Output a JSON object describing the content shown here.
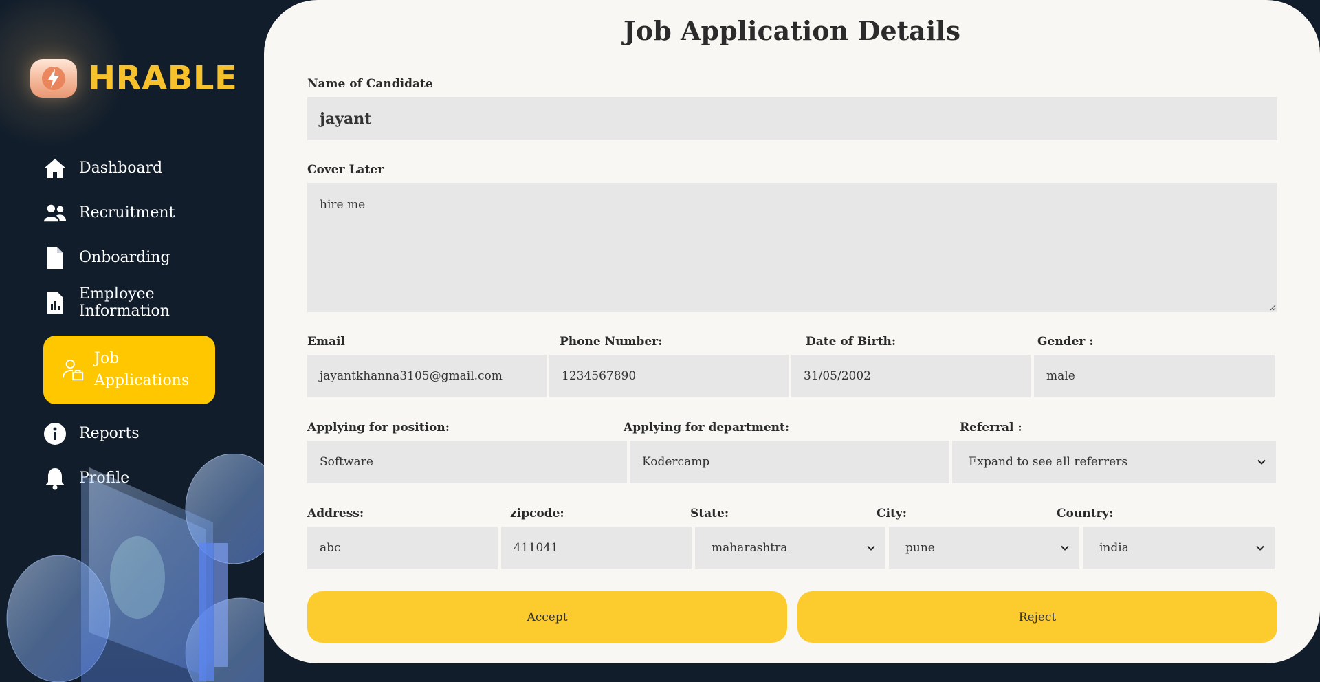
{
  "brand": {
    "name": "HRABLE"
  },
  "sidebar": {
    "items": [
      {
        "label": "Dashboard",
        "icon": "home-icon"
      },
      {
        "label": "Recruitment",
        "icon": "users-icon"
      },
      {
        "label": "Onboarding",
        "icon": "file-icon"
      },
      {
        "label": "Employee Information",
        "icon": "report-file-icon"
      },
      {
        "label": "Job Applications",
        "icon": "applicant-icon",
        "active": true
      },
      {
        "label": "Reports",
        "icon": "info-icon"
      },
      {
        "label": "Profile",
        "icon": "bell-icon"
      }
    ]
  },
  "form": {
    "title": "Job Application Details",
    "name": {
      "label": "Name of Candidate",
      "value": "jayant"
    },
    "cover": {
      "label": "Cover Later",
      "value": "hire me"
    },
    "email": {
      "label": "Email",
      "value": "jayantkhanna3105@gmail.com"
    },
    "phone": {
      "label": "Phone Number:",
      "value": "1234567890"
    },
    "dob": {
      "label": "Date of Birth:",
      "value": "31/05/2002"
    },
    "gender": {
      "label": "Gender :",
      "value": "male"
    },
    "position": {
      "label": "Applying for position:",
      "value": "Software"
    },
    "department": {
      "label": "Applying for department:",
      "value": "Kodercamp"
    },
    "referral": {
      "label": "Referral :",
      "value": "Expand to see all referrers"
    },
    "address": {
      "label": "Address:",
      "value": "abc"
    },
    "zipcode": {
      "label": "zipcode:",
      "value": "411041"
    },
    "state": {
      "label": "State:",
      "value": "maharashtra"
    },
    "city": {
      "label": "City:",
      "value": "pune"
    },
    "country": {
      "label": "Country:",
      "value": "india"
    }
  },
  "actions": {
    "accept": "Accept",
    "reject": "Reject"
  },
  "colors": {
    "background": "#111d2b",
    "accent": "#ffc700",
    "card": "#f8f7f3",
    "field": "#e7e7e7",
    "brand": "#f7c12c"
  }
}
